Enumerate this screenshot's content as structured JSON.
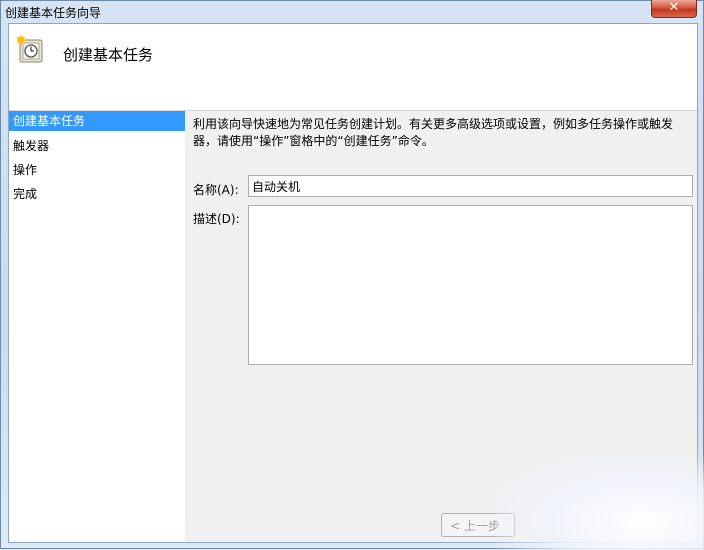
{
  "window": {
    "title": "创建基本任务向导",
    "close_label": "✕"
  },
  "header": {
    "title": "创建基本任务",
    "icon": "task-clock-icon"
  },
  "steps": [
    {
      "label": "创建基本任务",
      "active": true
    },
    {
      "label": "触发器",
      "active": false
    },
    {
      "label": "操作",
      "active": false
    },
    {
      "label": "完成",
      "active": false
    }
  ],
  "main": {
    "description": "利用该向导快速地为常见任务创建计划。有关更多高级选项或设置，例如多任务操作或触发器，请使用“操作”窗格中的“创建任务”命令。",
    "name_label": "名称(A):",
    "name_value": "自动关机",
    "desc_label": "描述(D):",
    "desc_value": ""
  },
  "footer": {
    "prev_label": "< 上一步"
  },
  "colors": {
    "selection": "#3399ff",
    "close_button": "#c2381f"
  }
}
